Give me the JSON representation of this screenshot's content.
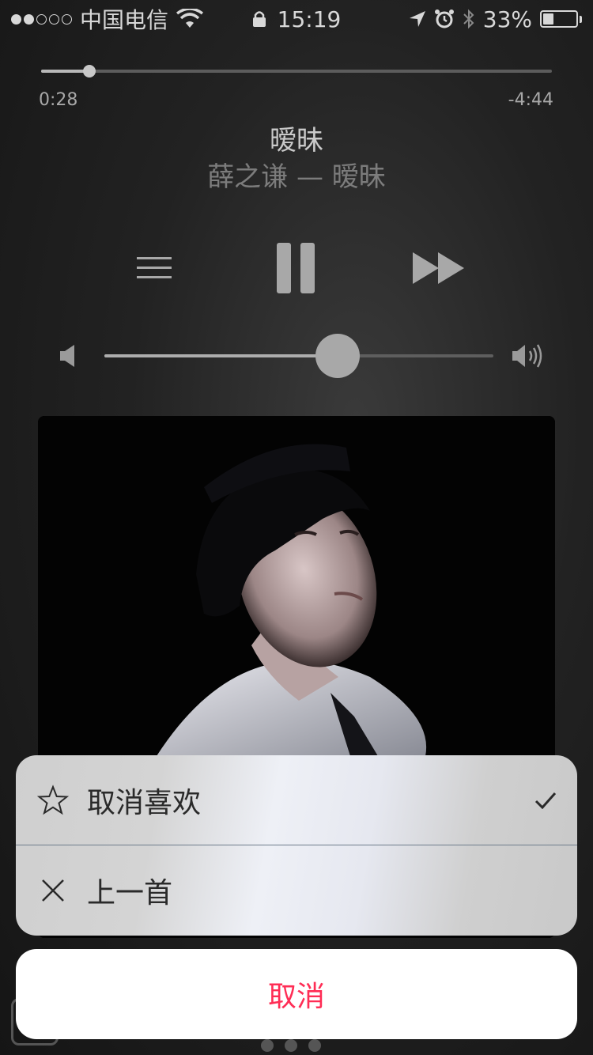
{
  "status_bar": {
    "carrier": "中国电信",
    "time": "15:19",
    "battery": "33%",
    "battery_level": 0.33
  },
  "player": {
    "elapsed": "0:28",
    "remaining": "-4:44",
    "progress": 0.095,
    "title": "暧昧",
    "subtitle": "薛之谦 — 暧昧",
    "volume": 0.6
  },
  "sheet": {
    "items": [
      {
        "label": "取消喜欢",
        "icon": "star-icon",
        "checked": true
      },
      {
        "label": "上一首",
        "icon": "close-icon",
        "checked": false
      }
    ],
    "cancel_label": "取消"
  },
  "colors": {
    "cancel_text": "#ff2d55",
    "background": "#222222"
  }
}
